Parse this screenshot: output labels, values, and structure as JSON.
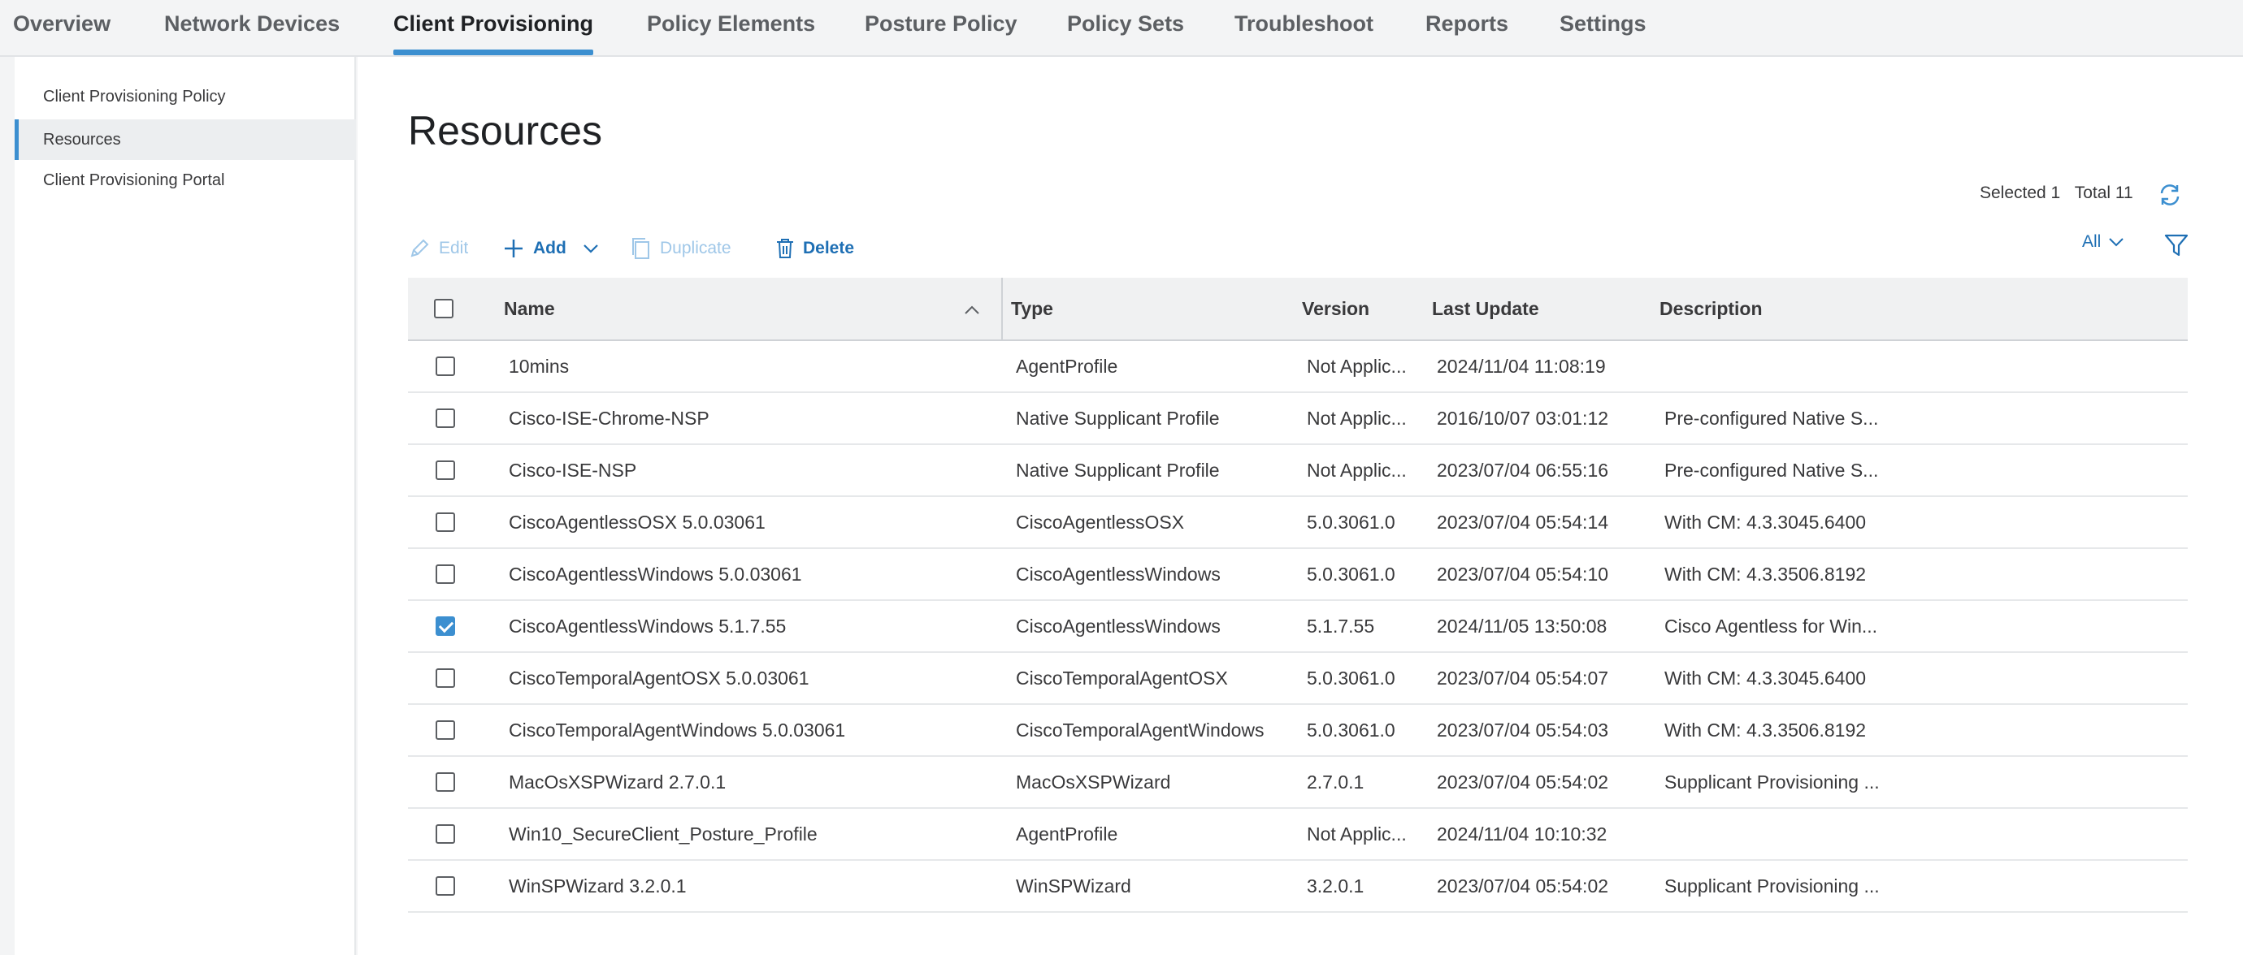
{
  "topnav": {
    "tabs": [
      {
        "label": "Overview"
      },
      {
        "label": "Network Devices"
      },
      {
        "label": "Client Provisioning",
        "active": true
      },
      {
        "label": "Policy Elements"
      },
      {
        "label": "Posture Policy"
      },
      {
        "label": "Policy Sets"
      },
      {
        "label": "Troubleshoot"
      },
      {
        "label": "Reports"
      },
      {
        "label": "Settings"
      }
    ]
  },
  "sidebar": {
    "items": [
      {
        "label": "Client Provisioning Policy"
      },
      {
        "label": "Resources",
        "active": true
      },
      {
        "label": "Client Provisioning Portal"
      }
    ]
  },
  "main": {
    "title": "Resources",
    "selected_label": "Selected 1",
    "total_label": "Total 11",
    "toolbar": {
      "edit": "Edit",
      "add": "Add",
      "duplicate": "Duplicate",
      "delete": "Delete"
    },
    "filter_label": "All",
    "columns": [
      "Name",
      "Type",
      "Version",
      "Last Update",
      "Description"
    ],
    "rows": [
      {
        "checked": false,
        "name": "10mins",
        "type": "AgentProfile",
        "version": "Not Applic...",
        "last_update": "2024/11/04 11:08:19",
        "description": ""
      },
      {
        "checked": false,
        "name": "Cisco-ISE-Chrome-NSP",
        "type": "Native Supplicant Profile",
        "version": "Not Applic...",
        "last_update": "2016/10/07 03:01:12",
        "description": "Pre-configured Native S..."
      },
      {
        "checked": false,
        "name": "Cisco-ISE-NSP",
        "type": "Native Supplicant Profile",
        "version": "Not Applic...",
        "last_update": "2023/07/04 06:55:16",
        "description": "Pre-configured Native S..."
      },
      {
        "checked": false,
        "name": "CiscoAgentlessOSX 5.0.03061",
        "type": "CiscoAgentlessOSX",
        "version": "5.0.3061.0",
        "last_update": "2023/07/04 05:54:14",
        "description": "With CM: 4.3.3045.6400"
      },
      {
        "checked": false,
        "name": "CiscoAgentlessWindows 5.0.03061",
        "type": "CiscoAgentlessWindows",
        "version": "5.0.3061.0",
        "last_update": "2023/07/04 05:54:10",
        "description": "With CM: 4.3.3506.8192"
      },
      {
        "checked": true,
        "name": "CiscoAgentlessWindows 5.1.7.55",
        "type": "CiscoAgentlessWindows",
        "version": "5.1.7.55",
        "last_update": "2024/11/05 13:50:08",
        "description": "Cisco Agentless for Win..."
      },
      {
        "checked": false,
        "name": "CiscoTemporalAgentOSX 5.0.03061",
        "type": "CiscoTemporalAgentOSX",
        "version": "5.0.3061.0",
        "last_update": "2023/07/04 05:54:07",
        "description": "With CM: 4.3.3045.6400"
      },
      {
        "checked": false,
        "name": "CiscoTemporalAgentWindows 5.0.03061",
        "type": "CiscoTemporalAgentWindows",
        "version": "5.0.3061.0",
        "last_update": "2023/07/04 05:54:03",
        "description": "With CM: 4.3.3506.8192"
      },
      {
        "checked": false,
        "name": "MacOsXSPWizard 2.7.0.1",
        "type": "MacOsXSPWizard",
        "version": "2.7.0.1",
        "last_update": "2023/07/04 05:54:02",
        "description": "Supplicant Provisioning ..."
      },
      {
        "checked": false,
        "name": "Win10_SecureClient_Posture_Profile",
        "type": "AgentProfile",
        "version": "Not Applic...",
        "last_update": "2024/11/04 10:10:32",
        "description": ""
      },
      {
        "checked": false,
        "name": "WinSPWizard 3.2.0.1",
        "type": "WinSPWizard",
        "version": "3.2.0.1",
        "last_update": "2023/07/04 05:54:02",
        "description": "Supplicant Provisioning ..."
      }
    ]
  },
  "colors": {
    "accent": "#3c8fd0",
    "link": "#1e6fb4",
    "disabled": "#9fc7e8"
  }
}
